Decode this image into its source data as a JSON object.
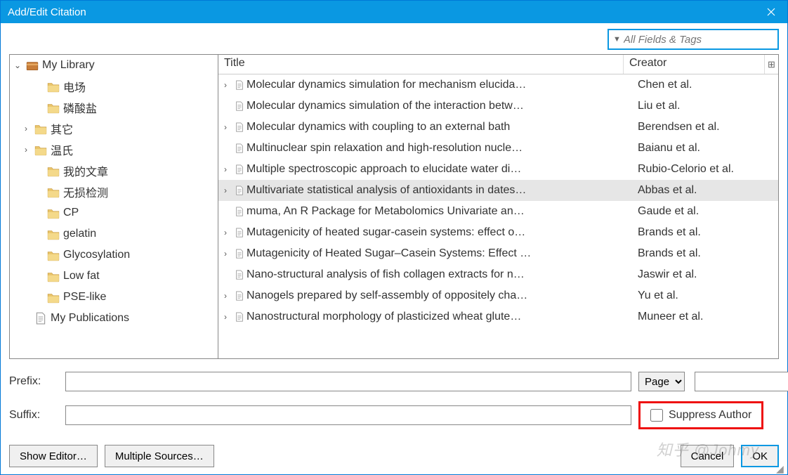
{
  "window": {
    "title": "Add/Edit Citation"
  },
  "search": {
    "placeholder": "All Fields & Tags"
  },
  "sidebar": {
    "items": [
      {
        "label": "My Library",
        "icon": "library",
        "depth": 0,
        "twisty": "open"
      },
      {
        "label": "电场",
        "icon": "folder",
        "depth": 2,
        "twisty": ""
      },
      {
        "label": "磷酸盐",
        "icon": "folder",
        "depth": 2,
        "twisty": ""
      },
      {
        "label": "其它",
        "icon": "folder",
        "depth": 1,
        "twisty": "closed"
      },
      {
        "label": "温氏",
        "icon": "folder",
        "depth": 1,
        "twisty": "closed"
      },
      {
        "label": "我的文章",
        "icon": "folder",
        "depth": 2,
        "twisty": ""
      },
      {
        "label": "无损检测",
        "icon": "folder",
        "depth": 2,
        "twisty": ""
      },
      {
        "label": "CP",
        "icon": "folder",
        "depth": 2,
        "twisty": ""
      },
      {
        "label": "gelatin",
        "icon": "folder",
        "depth": 2,
        "twisty": ""
      },
      {
        "label": "Glycosylation",
        "icon": "folder",
        "depth": 2,
        "twisty": ""
      },
      {
        "label": "Low fat",
        "icon": "folder",
        "depth": 2,
        "twisty": ""
      },
      {
        "label": "PSE-like",
        "icon": "folder",
        "depth": 2,
        "twisty": ""
      },
      {
        "label": "My Publications",
        "icon": "doc",
        "depth": 1,
        "twisty": ""
      }
    ]
  },
  "list": {
    "header": {
      "title": "Title",
      "creator": "Creator"
    },
    "selected_index": 5,
    "rows": [
      {
        "twisty": true,
        "title": "Molecular dynamics simulation for mechanism elucida…",
        "creator": "Chen et al."
      },
      {
        "twisty": false,
        "title": "Molecular dynamics simulation of the interaction betw…",
        "creator": "Liu et al."
      },
      {
        "twisty": true,
        "title": "Molecular dynamics with coupling to an external bath",
        "creator": "Berendsen et al."
      },
      {
        "twisty": false,
        "title": "Multinuclear spin relaxation and high-resolution nucle…",
        "creator": "Baianu et al."
      },
      {
        "twisty": true,
        "title": "Multiple spectroscopic approach to elucidate water di…",
        "creator": "Rubio-Celorio et al."
      },
      {
        "twisty": true,
        "title": "Multivariate statistical analysis of antioxidants in dates…",
        "creator": "Abbas et al."
      },
      {
        "twisty": false,
        "title": "muma, An R Package for Metabolomics Univariate an…",
        "creator": "Gaude et al."
      },
      {
        "twisty": true,
        "title": "Mutagenicity of heated sugar-casein systems: effect o…",
        "creator": "Brands et al."
      },
      {
        "twisty": true,
        "title": "Mutagenicity of Heated Sugar–Casein Systems: Effect …",
        "creator": "Brands et al."
      },
      {
        "twisty": false,
        "title": "Nano-structural analysis of fish collagen extracts for n…",
        "creator": "Jaswir et al."
      },
      {
        "twisty": true,
        "title": "Nanogels prepared by self-assembly of oppositely cha…",
        "creator": "Yu et al."
      },
      {
        "twisty": true,
        "title": "Nanostructural morphology of plasticized wheat glute…",
        "creator": "Muneer et al."
      }
    ]
  },
  "form": {
    "prefix_label": "Prefix:",
    "suffix_label": "Suffix:",
    "locator_type": "Page",
    "suppress_label": "Suppress Author"
  },
  "buttons": {
    "show_editor": "Show Editor…",
    "multiple_sources": "Multiple Sources…",
    "cancel": "Cancel",
    "ok": "OK"
  },
  "watermark": "知乎 @Johmy"
}
